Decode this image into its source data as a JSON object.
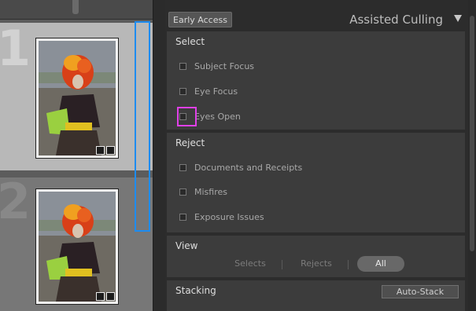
{
  "grid": {
    "cells": [
      {
        "index": "1",
        "selected": true
      },
      {
        "index": "2",
        "selected": false
      }
    ]
  },
  "panel": {
    "badge": "Early Access",
    "title": "Assisted Culling",
    "select": {
      "title": "Select",
      "options": [
        {
          "label": "Subject Focus",
          "checked": false
        },
        {
          "label": "Eye Focus",
          "checked": false
        },
        {
          "label": "Eyes Open",
          "checked": false
        }
      ]
    },
    "reject": {
      "title": "Reject",
      "options": [
        {
          "label": "Documents and Receipts",
          "checked": false
        },
        {
          "label": "Misfires",
          "checked": false
        },
        {
          "label": "Exposure Issues",
          "checked": false
        }
      ]
    },
    "view": {
      "title": "View",
      "options": [
        "Selects",
        "Rejects",
        "All"
      ],
      "active": "All"
    },
    "stacking": {
      "title": "Stacking",
      "button": "Auto-Stack"
    }
  },
  "colors": {
    "selection_outline": "#1e8cf0",
    "focus_outline": "#e040e8"
  }
}
